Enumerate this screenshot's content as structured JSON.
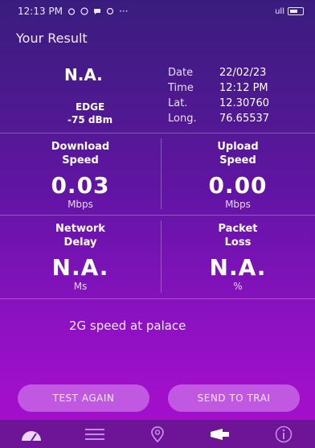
{
  "status_bar": {
    "time": "12:13 PM",
    "dots": "···",
    "signal": "ull"
  },
  "header": {
    "title": "Your Result"
  },
  "summary_top": {
    "na": "N.A.",
    "network_type": "EDGE",
    "signal_strength": "-75 dBm",
    "date_label": "Date",
    "date_value": "22/02/23",
    "time_label": "Time",
    "time_value": "12:12 PM",
    "lat_label": "Lat.",
    "lat_value": "12.30760",
    "long_label": "Long.",
    "long_value": "76.65537"
  },
  "download": {
    "label1": "Download",
    "label2": "Speed",
    "value": "0.03",
    "unit": "Mbps"
  },
  "upload": {
    "label1": "Upload",
    "label2": "Speed",
    "value": "0.00",
    "unit": "Mbps"
  },
  "delay": {
    "label1": "Network",
    "label2": "Delay",
    "value": "N.A.",
    "unit": "Ms"
  },
  "loss": {
    "label1": "Packet",
    "label2": "Loss",
    "value": "N.A.",
    "unit": "%"
  },
  "summary_text": "2G speed at palace",
  "buttons": {
    "test_again": "TEST AGAIN",
    "send_to_trai": "SEND TO TRAI"
  },
  "nav": {
    "items": [
      {
        "icon": "speedometer-icon"
      },
      {
        "icon": "list-icon"
      },
      {
        "icon": "location-pin-icon"
      },
      {
        "icon": "megaphone-icon"
      },
      {
        "icon": "info-icon"
      }
    ]
  },
  "colors": {
    "background_top": "#3a1c7e",
    "background_bottom": "#a20fc9",
    "button": "#d896f5",
    "nav": "#6e1496"
  }
}
